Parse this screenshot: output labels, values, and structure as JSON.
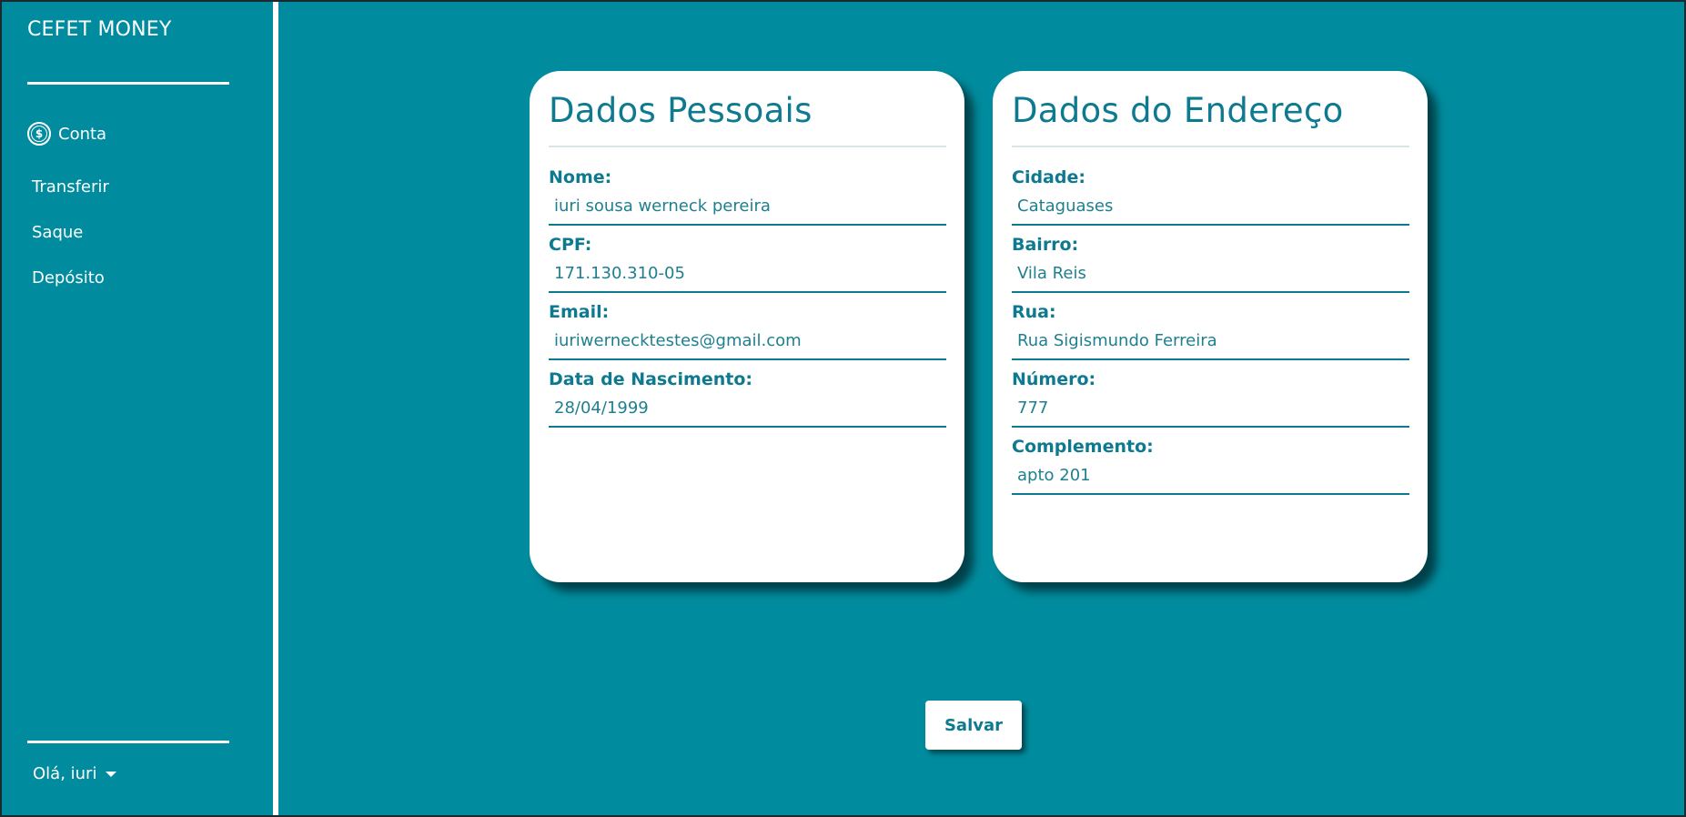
{
  "sidebar": {
    "brand": "CEFET MONEY",
    "items": [
      {
        "label": "Conta",
        "icon": "dollar-coin-icon"
      },
      {
        "label": "Transferir"
      },
      {
        "label": "Saque"
      },
      {
        "label": "Depósito"
      }
    ],
    "coin_symbol": "$",
    "user_menu_label": "Olá, iuri"
  },
  "personal": {
    "title": "Dados Pessoais",
    "fields": [
      {
        "label": "Nome:",
        "value": "iuri sousa werneck pereira"
      },
      {
        "label": "CPF:",
        "value": "171.130.310-05"
      },
      {
        "label": "Email:",
        "value": "iuriwernecktestes@gmail.com"
      },
      {
        "label": "Data de Nascimento:",
        "value": "28/04/1999"
      }
    ]
  },
  "address": {
    "title": "Dados do Endereço",
    "fields": [
      {
        "label": "Cidade:",
        "value": "Cataguases"
      },
      {
        "label": "Bairro:",
        "value": "Vila Reis"
      },
      {
        "label": "Rua:",
        "value": "Rua Sigismundo Ferreira"
      },
      {
        "label": "Número:",
        "value": "777"
      },
      {
        "label": "Complemento:",
        "value": "apto 201"
      }
    ]
  },
  "actions": {
    "save_label": "Salvar"
  },
  "colors": {
    "background": "#008c9e",
    "accent": "#0e7a8f",
    "card": "#ffffff"
  }
}
